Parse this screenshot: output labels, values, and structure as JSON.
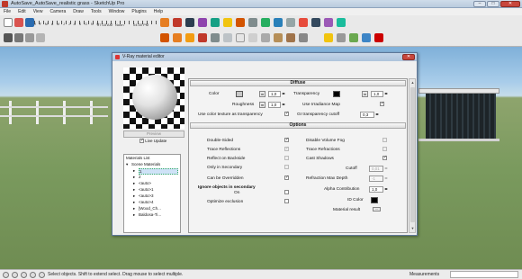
{
  "window": {
    "title": "AutoSave_AutoSave_realistic grass - SketchUp Pro",
    "minimize_label": "–",
    "maximize_label": "□",
    "close_label": "✕"
  },
  "menu": [
    "File",
    "Edit",
    "View",
    "Camera",
    "Draw",
    "Tools",
    "Window",
    "Plugins",
    "Help"
  ],
  "shadow_toolbar": {
    "months": [
      "J",
      "F",
      "M",
      "A",
      "M",
      "J",
      "J",
      "A",
      "S",
      "O",
      "N",
      "D"
    ],
    "time_start": "07:18 AM",
    "time_noon": "Noon",
    "time_end": "04:30 PM"
  },
  "dialog": {
    "title": "V-Ray material editor",
    "close_label": "✕",
    "preview_button": "Preview",
    "live_update_label": "Live Update",
    "live_update_checked": true,
    "materials_list": {
      "header": "Materials List",
      "root": "Scene Materials",
      "items": [
        "1",
        "2",
        "<auto>",
        "<auto>1",
        "<auto>3",
        "<auto>4",
        "[Wood_Ch...",
        "Baldosa-Ti..."
      ],
      "selected_index": 0
    },
    "diffuse": {
      "section_label": "Diffuse",
      "color_label": "Color",
      "color_swatch": "#c8c8c8",
      "color_map_label": "m",
      "color_value": "1,0",
      "transparency_label": "Transparency",
      "transparency_swatch": "#000000",
      "transparency_map_label": "m",
      "transparency_value": "1,0",
      "roughness_label": "Roughness",
      "roughness_map_label": "m",
      "roughness_value": "1,0",
      "use_irradiance_label": "Use Irradiance Map",
      "use_irradiance_checked": true,
      "color_tex_transparency_label": "Use color texture as transparency",
      "color_tex_transparency_checked": true,
      "gi_cutoff_label": "GI transparency cutoff",
      "gi_cutoff_value": "0,3"
    },
    "options": {
      "section_label": "Options",
      "left": [
        {
          "label": "Double-Sided",
          "checked": true,
          "disabled": false
        },
        {
          "label": "Trace Reflections",
          "checked": true,
          "disabled": true
        },
        {
          "label": "Reflect on Backside",
          "checked": false,
          "disabled": true
        },
        {
          "label": "Only in Secondary",
          "checked": false,
          "disabled": true
        },
        {
          "label": "Can be Overridden",
          "checked": true,
          "disabled": false
        }
      ],
      "ignore_secondary_label": "Ignore objects in secondary",
      "ignore_secondary_on_label": "On",
      "ignore_secondary_checked": false,
      "optimize_exclusion_label": "Optimize exclusion",
      "optimize_exclusion_checked": false,
      "right": [
        {
          "label": "Disable Volume Fog",
          "checked": false,
          "disabled": true
        },
        {
          "label": "Trace Refractions",
          "checked": false,
          "disabled": true
        },
        {
          "label": "Cast Shadows",
          "checked": true,
          "disabled": false
        }
      ],
      "cutoff_label": "Cutoff",
      "cutoff_value": "0,01",
      "refraction_depth_label": "Refraction Max Depth",
      "refraction_depth_value": "-1",
      "alpha_label": "Alpha Contribution",
      "alpha_value": "1,0",
      "id_color_label": "ID Color",
      "id_color_swatch": "#000000",
      "material_result_label": "Material result",
      "material_result_button": "..."
    }
  },
  "status": {
    "message": "Select objects. Shift to extend select. Drag mouse to select multiple.",
    "measurements_label": "Measurements"
  }
}
